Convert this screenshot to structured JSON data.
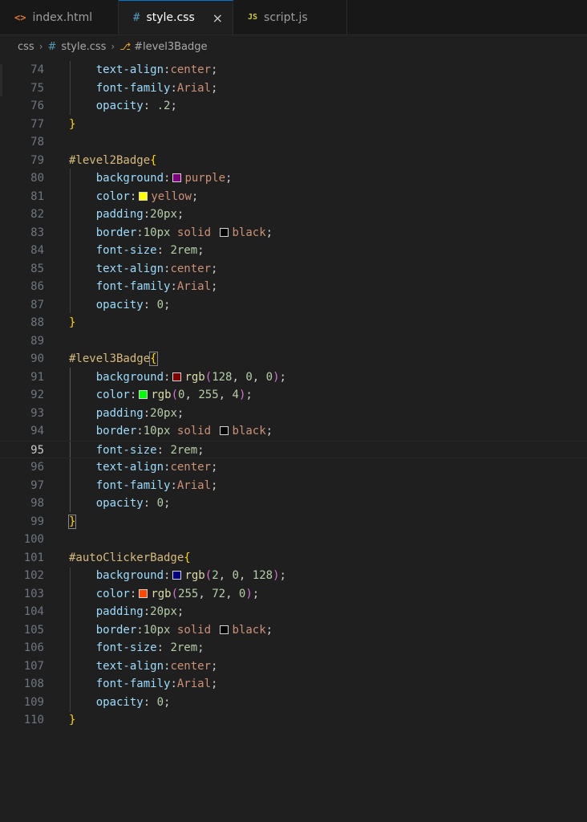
{
  "tabs": [
    {
      "icon": "<>",
      "label": "index.html"
    },
    {
      "icon": "#",
      "label": "style.css",
      "close": "×"
    },
    {
      "icon": "JS",
      "label": "script.js"
    }
  ],
  "breadcrumb": {
    "folder": "css",
    "file_icon": "#",
    "file": "style.css",
    "symbol": "#level3Badge"
  },
  "colors": {
    "purple": "#800080",
    "yellow": "#ffff00",
    "black": "#000000",
    "level3_bg": "#800000",
    "level3_fg": "#00ff04",
    "auto_bg": "#020080",
    "auto_fg": "#ff4800"
  },
  "lines": [
    {
      "n": "74",
      "segs": [
        [
          "prop",
          "text-align"
        ],
        [
          "punc",
          ":"
        ],
        [
          "val",
          "center"
        ],
        [
          "punc",
          ";"
        ]
      ]
    },
    {
      "n": "75",
      "segs": [
        [
          "prop",
          "font-family"
        ],
        [
          "punc",
          ":"
        ],
        [
          "val",
          "Arial"
        ],
        [
          "punc",
          ";"
        ]
      ]
    },
    {
      "n": "76",
      "segs": [
        [
          "prop",
          "opacity"
        ],
        [
          "punc",
          ": "
        ],
        [
          "num",
          ".2"
        ],
        [
          "punc",
          ";"
        ]
      ]
    },
    {
      "n": "77",
      "segs": [
        [
          "br",
          "}"
        ]
      ]
    },
    {
      "n": "78",
      "segs": []
    },
    {
      "n": "79",
      "segs": [
        [
          "sel",
          "#level2Badge"
        ],
        [
          "br",
          "{"
        ]
      ]
    },
    {
      "n": "80",
      "segs": [
        [
          "prop",
          "background"
        ],
        [
          "punc",
          ":"
        ],
        [
          "swatch",
          "#800080"
        ],
        [
          "val",
          "purple"
        ],
        [
          "punc",
          ";"
        ]
      ]
    },
    {
      "n": "81",
      "segs": [
        [
          "prop",
          "color"
        ],
        [
          "punc",
          ":"
        ],
        [
          "swatch",
          "#ffff00"
        ],
        [
          "val",
          "yellow"
        ],
        [
          "punc",
          ";"
        ]
      ]
    },
    {
      "n": "82",
      "segs": [
        [
          "prop",
          "padding"
        ],
        [
          "punc",
          ":"
        ],
        [
          "num",
          "20px"
        ],
        [
          "punc",
          ";"
        ]
      ]
    },
    {
      "n": "83",
      "segs": [
        [
          "prop",
          "border"
        ],
        [
          "punc",
          ":"
        ],
        [
          "num",
          "10px"
        ],
        [
          "punc",
          " "
        ],
        [
          "val",
          "solid"
        ],
        [
          "punc",
          " "
        ],
        [
          "swatch",
          "#000000"
        ],
        [
          "val",
          "black"
        ],
        [
          "punc",
          ";"
        ]
      ]
    },
    {
      "n": "84",
      "segs": [
        [
          "prop",
          "font-size"
        ],
        [
          "punc",
          ": "
        ],
        [
          "num",
          "2rem"
        ],
        [
          "punc",
          ";"
        ]
      ]
    },
    {
      "n": "85",
      "segs": [
        [
          "prop",
          "text-align"
        ],
        [
          "punc",
          ":"
        ],
        [
          "val",
          "center"
        ],
        [
          "punc",
          ";"
        ]
      ]
    },
    {
      "n": "86",
      "segs": [
        [
          "prop",
          "font-family"
        ],
        [
          "punc",
          ":"
        ],
        [
          "val",
          "Arial"
        ],
        [
          "punc",
          ";"
        ]
      ]
    },
    {
      "n": "87",
      "segs": [
        [
          "prop",
          "opacity"
        ],
        [
          "punc",
          ": "
        ],
        [
          "num",
          "0"
        ],
        [
          "punc",
          ";"
        ]
      ]
    },
    {
      "n": "88",
      "segs": [
        [
          "br",
          "}"
        ]
      ]
    },
    {
      "n": "89",
      "segs": []
    },
    {
      "n": "90",
      "segs": [
        [
          "sel",
          "#level3Badge"
        ],
        [
          "brm",
          "{"
        ]
      ]
    },
    {
      "n": "91",
      "segs": [
        [
          "prop",
          "background"
        ],
        [
          "punc",
          ":"
        ],
        [
          "swatch",
          "#800000"
        ],
        [
          "fn",
          "rgb"
        ],
        [
          "paren",
          "("
        ],
        [
          "num",
          "128"
        ],
        [
          "punc",
          ", "
        ],
        [
          "num",
          "0"
        ],
        [
          "punc",
          ", "
        ],
        [
          "num",
          "0"
        ],
        [
          "paren",
          ")"
        ],
        [
          "punc",
          ";"
        ]
      ]
    },
    {
      "n": "92",
      "segs": [
        [
          "prop",
          "color"
        ],
        [
          "punc",
          ":"
        ],
        [
          "swatch",
          "#00ff04"
        ],
        [
          "fn",
          "rgb"
        ],
        [
          "paren",
          "("
        ],
        [
          "num",
          "0"
        ],
        [
          "punc",
          ", "
        ],
        [
          "num",
          "255"
        ],
        [
          "punc",
          ", "
        ],
        [
          "num",
          "4"
        ],
        [
          "paren",
          ")"
        ],
        [
          "punc",
          ";"
        ]
      ]
    },
    {
      "n": "93",
      "segs": [
        [
          "prop",
          "padding"
        ],
        [
          "punc",
          ":"
        ],
        [
          "num",
          "20px"
        ],
        [
          "punc",
          ";"
        ]
      ]
    },
    {
      "n": "94",
      "segs": [
        [
          "prop",
          "border"
        ],
        [
          "punc",
          ":"
        ],
        [
          "num",
          "10px"
        ],
        [
          "punc",
          " "
        ],
        [
          "val",
          "solid"
        ],
        [
          "punc",
          " "
        ],
        [
          "swatch",
          "#000000"
        ],
        [
          "val",
          "black"
        ],
        [
          "punc",
          ";"
        ]
      ]
    },
    {
      "n": "95",
      "segs": [
        [
          "prop",
          "font-size"
        ],
        [
          "punc",
          ": "
        ],
        [
          "num",
          "2rem"
        ],
        [
          "punc",
          ";"
        ]
      ]
    },
    {
      "n": "96",
      "segs": [
        [
          "prop",
          "text-align"
        ],
        [
          "punc",
          ":"
        ],
        [
          "val",
          "center"
        ],
        [
          "punc",
          ";"
        ]
      ]
    },
    {
      "n": "97",
      "segs": [
        [
          "prop",
          "font-family"
        ],
        [
          "punc",
          ":"
        ],
        [
          "val",
          "Arial"
        ],
        [
          "punc",
          ";"
        ]
      ]
    },
    {
      "n": "98",
      "segs": [
        [
          "prop",
          "opacity"
        ],
        [
          "punc",
          ": "
        ],
        [
          "num",
          "0"
        ],
        [
          "punc",
          ";"
        ]
      ]
    },
    {
      "n": "99",
      "segs": [
        [
          "brm",
          "}"
        ]
      ]
    },
    {
      "n": "100",
      "segs": []
    },
    {
      "n": "101",
      "segs": [
        [
          "sel",
          "#autoClickerBadge"
        ],
        [
          "br",
          "{"
        ]
      ]
    },
    {
      "n": "102",
      "segs": [
        [
          "prop",
          "background"
        ],
        [
          "punc",
          ":"
        ],
        [
          "swatch",
          "#020080"
        ],
        [
          "fn",
          "rgb"
        ],
        [
          "paren",
          "("
        ],
        [
          "num",
          "2"
        ],
        [
          "punc",
          ", "
        ],
        [
          "num",
          "0"
        ],
        [
          "punc",
          ", "
        ],
        [
          "num",
          "128"
        ],
        [
          "paren",
          ")"
        ],
        [
          "punc",
          ";"
        ]
      ]
    },
    {
      "n": "103",
      "segs": [
        [
          "prop",
          "color"
        ],
        [
          "punc",
          ":"
        ],
        [
          "swatch",
          "#ff4800"
        ],
        [
          "fn",
          "rgb"
        ],
        [
          "paren",
          "("
        ],
        [
          "num",
          "255"
        ],
        [
          "punc",
          ", "
        ],
        [
          "num",
          "72"
        ],
        [
          "punc",
          ", "
        ],
        [
          "num",
          "0"
        ],
        [
          "paren",
          ")"
        ],
        [
          "punc",
          ";"
        ]
      ]
    },
    {
      "n": "104",
      "segs": [
        [
          "prop",
          "padding"
        ],
        [
          "punc",
          ":"
        ],
        [
          "num",
          "20px"
        ],
        [
          "punc",
          ";"
        ]
      ]
    },
    {
      "n": "105",
      "segs": [
        [
          "prop",
          "border"
        ],
        [
          "punc",
          ":"
        ],
        [
          "num",
          "10px"
        ],
        [
          "punc",
          " "
        ],
        [
          "val",
          "solid"
        ],
        [
          "punc",
          " "
        ],
        [
          "swatch",
          "#000000"
        ],
        [
          "val",
          "black"
        ],
        [
          "punc",
          ";"
        ]
      ]
    },
    {
      "n": "106",
      "segs": [
        [
          "prop",
          "font-size"
        ],
        [
          "punc",
          ": "
        ],
        [
          "num",
          "2rem"
        ],
        [
          "punc",
          ";"
        ]
      ]
    },
    {
      "n": "107",
      "segs": [
        [
          "prop",
          "text-align"
        ],
        [
          "punc",
          ":"
        ],
        [
          "val",
          "center"
        ],
        [
          "punc",
          ";"
        ]
      ]
    },
    {
      "n": "108",
      "segs": [
        [
          "prop",
          "font-family"
        ],
        [
          "punc",
          ":"
        ],
        [
          "val",
          "Arial"
        ],
        [
          "punc",
          ";"
        ]
      ]
    },
    {
      "n": "109",
      "segs": [
        [
          "prop",
          "opacity"
        ],
        [
          "punc",
          ": "
        ],
        [
          "num",
          "0"
        ],
        [
          "punc",
          ";"
        ]
      ]
    },
    {
      "n": "110",
      "segs": [
        [
          "br",
          "}"
        ]
      ]
    }
  ],
  "active_line": "95"
}
